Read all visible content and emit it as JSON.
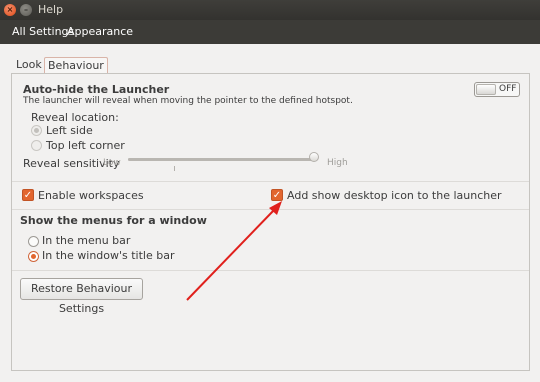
{
  "window": {
    "title": "Help",
    "close_glyph": "×",
    "minimize_glyph": "–",
    "maximize_glyph": "□"
  },
  "toolbar": {
    "items": [
      "All Settings",
      "Appearance"
    ]
  },
  "tabs": [
    {
      "label": "Look",
      "active": false
    },
    {
      "label": "Behaviour",
      "active": true
    }
  ],
  "autohide": {
    "title": "Auto-hide the Launcher",
    "description": "The launcher will reveal when moving the pointer to the defined hotspot.",
    "toggle_state": "OFF",
    "reveal_location_label": "Reveal location:",
    "options": [
      {
        "label": "Left side",
        "selected": true
      },
      {
        "label": "Top left corner",
        "selected": false
      }
    ],
    "sensitivity_label": "Reveal sensitivity",
    "low_label": "Low",
    "high_label": "High",
    "sensitivity_value": 1.0
  },
  "checkboxes": {
    "workspaces": {
      "label": "Enable workspaces",
      "checked": true
    },
    "desktop_icon": {
      "label": "Add show desktop icon to the launcher",
      "checked": true
    },
    "check_glyph": "✓"
  },
  "menus": {
    "title": "Show the menus for a window",
    "options": [
      {
        "label": "In the menu bar",
        "selected": false
      },
      {
        "label": "In the window's title bar",
        "selected": true
      }
    ]
  },
  "restore_button": {
    "label": "Restore Behaviour Settings"
  },
  "colors": {
    "accent": "#e2662f",
    "titlebar": "#3c3b37",
    "annotation_arrow": "#e0201c"
  }
}
